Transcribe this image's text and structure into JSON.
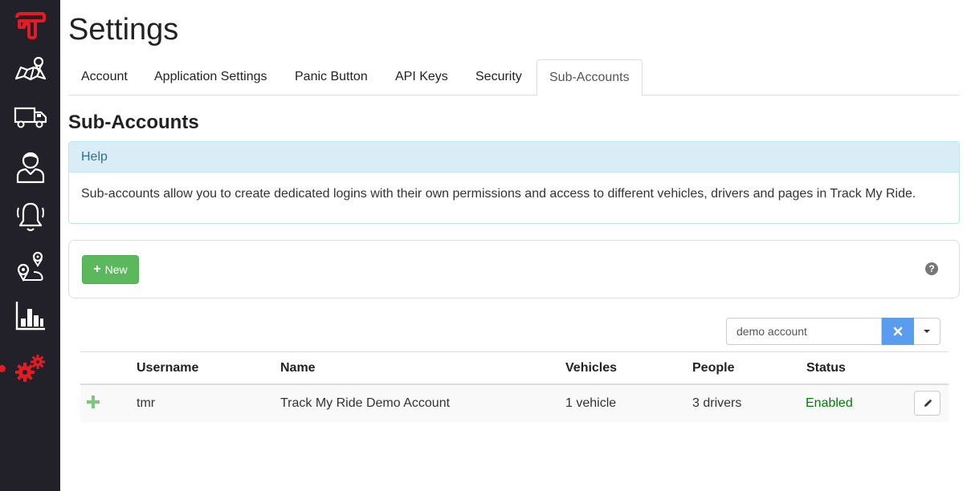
{
  "sidebar": {
    "items": [
      {
        "icon": "logo-icon"
      },
      {
        "icon": "map-icon"
      },
      {
        "icon": "truck-icon"
      },
      {
        "icon": "driver-icon"
      },
      {
        "icon": "alarm-bell-icon"
      },
      {
        "icon": "route-icon"
      },
      {
        "icon": "bar-chart-icon"
      },
      {
        "icon": "settings-gears-icon",
        "active": true
      }
    ],
    "brand_color": "#e31b23"
  },
  "page": {
    "title": "Settings"
  },
  "tabs": [
    {
      "label": "Account"
    },
    {
      "label": "Application Settings"
    },
    {
      "label": "Panic Button"
    },
    {
      "label": "API Keys"
    },
    {
      "label": "Security"
    },
    {
      "label": "Sub-Accounts",
      "active": true
    }
  ],
  "section": {
    "title": "Sub-Accounts"
  },
  "help": {
    "heading": "Help",
    "body": "Sub-accounts allow you to create dedicated logins with their own permissions and access to different vehicles, drivers and pages in Track My Ride."
  },
  "toolbar": {
    "new_label": "New",
    "new_icon": "plus-icon",
    "help_icon": "question-circle-icon"
  },
  "search": {
    "value": "demo account",
    "clear_icon": "close-icon",
    "dropdown_icon": "caret-down-icon"
  },
  "table": {
    "columns": [
      "Username",
      "Name",
      "Vehicles",
      "People",
      "Status"
    ],
    "rows": [
      {
        "username": "tmr",
        "name": "Track My Ride Demo Account",
        "vehicles": "1 vehicle",
        "people": "3 drivers",
        "status": "Enabled"
      }
    ]
  },
  "colors": {
    "success": "#5cb85c",
    "info_bg": "#d9edf7",
    "status_enabled": "#008000",
    "clear_button": "#5a9df0"
  }
}
